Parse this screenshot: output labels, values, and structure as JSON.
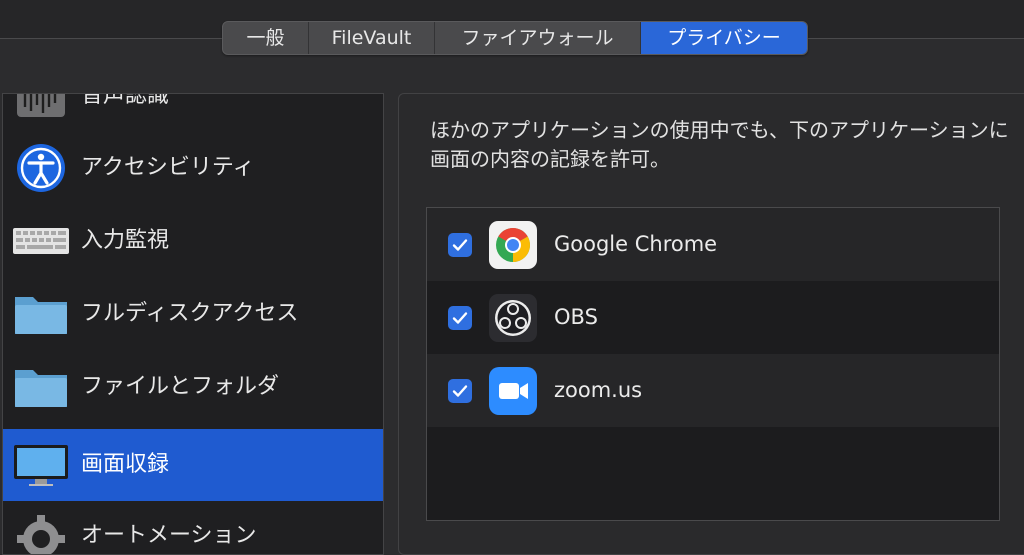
{
  "tabs": [
    {
      "label": "一般",
      "active": false
    },
    {
      "label": "FileVault",
      "active": false
    },
    {
      "label": "ファイアウォール",
      "active": false
    },
    {
      "label": "プライバシー",
      "active": true
    }
  ],
  "sidebar": {
    "items": [
      {
        "label": "音声認識",
        "icon": "speech-recognition-icon"
      },
      {
        "label": "アクセシビリティ",
        "icon": "accessibility-icon"
      },
      {
        "label": "入力監視",
        "icon": "keyboard-icon"
      },
      {
        "label": "フルディスクアクセス",
        "icon": "folder-icon"
      },
      {
        "label": "ファイルとフォルダ",
        "icon": "folder-icon"
      },
      {
        "label": "画面収録",
        "icon": "display-icon",
        "selected": true
      },
      {
        "label": "オートメーション",
        "icon": "gear-icon"
      }
    ]
  },
  "panel": {
    "description": "ほかのアプリケーションの使用中でも、下のアプリケーションに画面の内容の記録を許可。"
  },
  "apps": [
    {
      "name": "Google Chrome",
      "checked": true,
      "icon": "chrome-icon"
    },
    {
      "name": "OBS",
      "checked": true,
      "icon": "obs-icon"
    },
    {
      "name": "zoom.us",
      "checked": true,
      "icon": "zoom-icon"
    }
  ],
  "colors": {
    "accent": "#2a67d8",
    "selection": "#1f5bd0",
    "checkbox": "#2f6fe0",
    "zoom": "#2d8cff"
  }
}
